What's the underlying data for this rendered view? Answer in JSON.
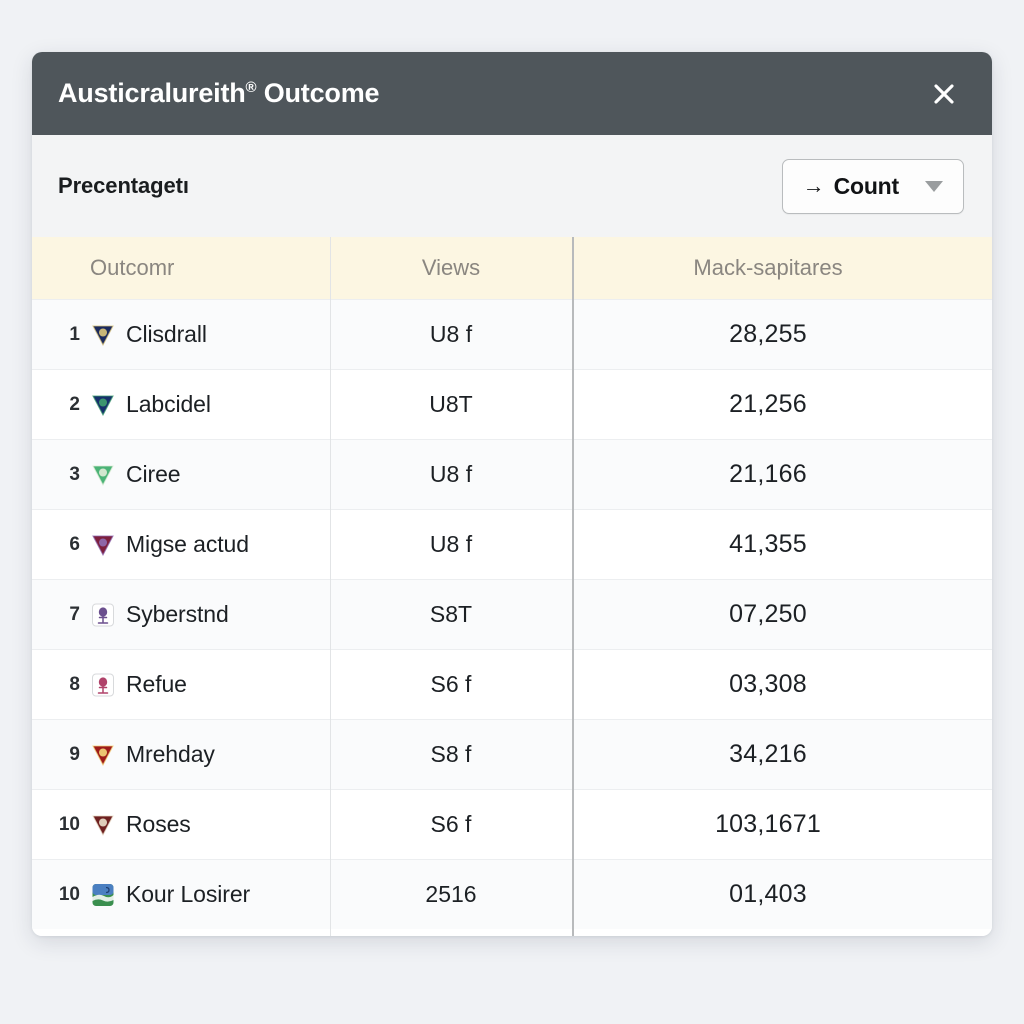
{
  "window": {
    "title_main": "Austicralureith",
    "title_sup": "®",
    "title_suffix": " Outcome",
    "close_icon": "close-icon",
    "header_bg": "#4f565b"
  },
  "toolbar": {
    "label": "Precentagetı",
    "select": {
      "arrow_glyph": "→",
      "label": "Count",
      "caret_icon": "chevron-down-icon"
    }
  },
  "table": {
    "columns": [
      {
        "key": "outcome",
        "label": "Outcomr"
      },
      {
        "key": "views",
        "label": "Views"
      },
      {
        "key": "metric",
        "label": "Mack-sapitares"
      }
    ],
    "rows": [
      {
        "rank": "1",
        "name": "Clisdrall",
        "views": "U8 f",
        "metric": "28,255",
        "badge": "pennant-navy-icon",
        "badge_shape": "pennant",
        "badge_color": "#1b2a5e",
        "badge_accent": "#d7c27a"
      },
      {
        "rank": "2",
        "name": "Labcidel",
        "views": "U8T",
        "metric": "21,256",
        "badge": "pennant-blue-icon",
        "badge_shape": "pennant",
        "badge_color": "#16306b",
        "badge_accent": "#3f9e6f"
      },
      {
        "rank": "3",
        "name": "Ciree",
        "views": "U8 f",
        "metric": "21,166",
        "badge": "pennant-green-icon",
        "badge_shape": "pennant",
        "badge_color": "#4bb377",
        "badge_accent": "#dcecd6"
      },
      {
        "rank": "6",
        "name": "Migse actud",
        "views": "U8 f",
        "metric": "41,355",
        "badge": "pennant-purple-icon",
        "badge_shape": "pennant",
        "badge_color": "#7d1f3d",
        "badge_accent": "#8f6bb0"
      },
      {
        "rank": "7",
        "name": "Syberstnd",
        "views": "S8T",
        "metric": "07,250",
        "badge": "crest-figure-icon",
        "badge_shape": "square",
        "badge_color": "#ffffff",
        "badge_accent": "#6b4f8e"
      },
      {
        "rank": "8",
        "name": "Refue",
        "views": "S6 f",
        "metric": "03,308",
        "badge": "crest-person-icon",
        "badge_shape": "square",
        "badge_color": "#ffffff",
        "badge_accent": "#b0426a"
      },
      {
        "rank": "9",
        "name": "Mrehday",
        "views": "S8 f",
        "metric": "34,216",
        "badge": "pennant-red-icon",
        "badge_shape": "pennant",
        "badge_color": "#9e1b1b",
        "badge_accent": "#f3d27a"
      },
      {
        "rank": "10",
        "name": "Roses",
        "views": "S6 f",
        "metric": "103,1671",
        "badge": "pennant-maroon-icon",
        "badge_shape": "pennant",
        "badge_color": "#6e2020",
        "badge_accent": "#e8dcc8"
      },
      {
        "rank": "10",
        "name": "Kour Losirer",
        "views": "2516",
        "metric": "01,403",
        "badge": "crest-landscape-icon",
        "badge_shape": "square",
        "badge_color": "#3a8f4f",
        "badge_accent": "#4a7fc1"
      }
    ]
  },
  "colors": {
    "page_bg": "#f0f2f5",
    "card_bg": "#ffffff",
    "header_row_bg": "#fcf6e2",
    "toolbar_bg": "#f3f4f5"
  }
}
